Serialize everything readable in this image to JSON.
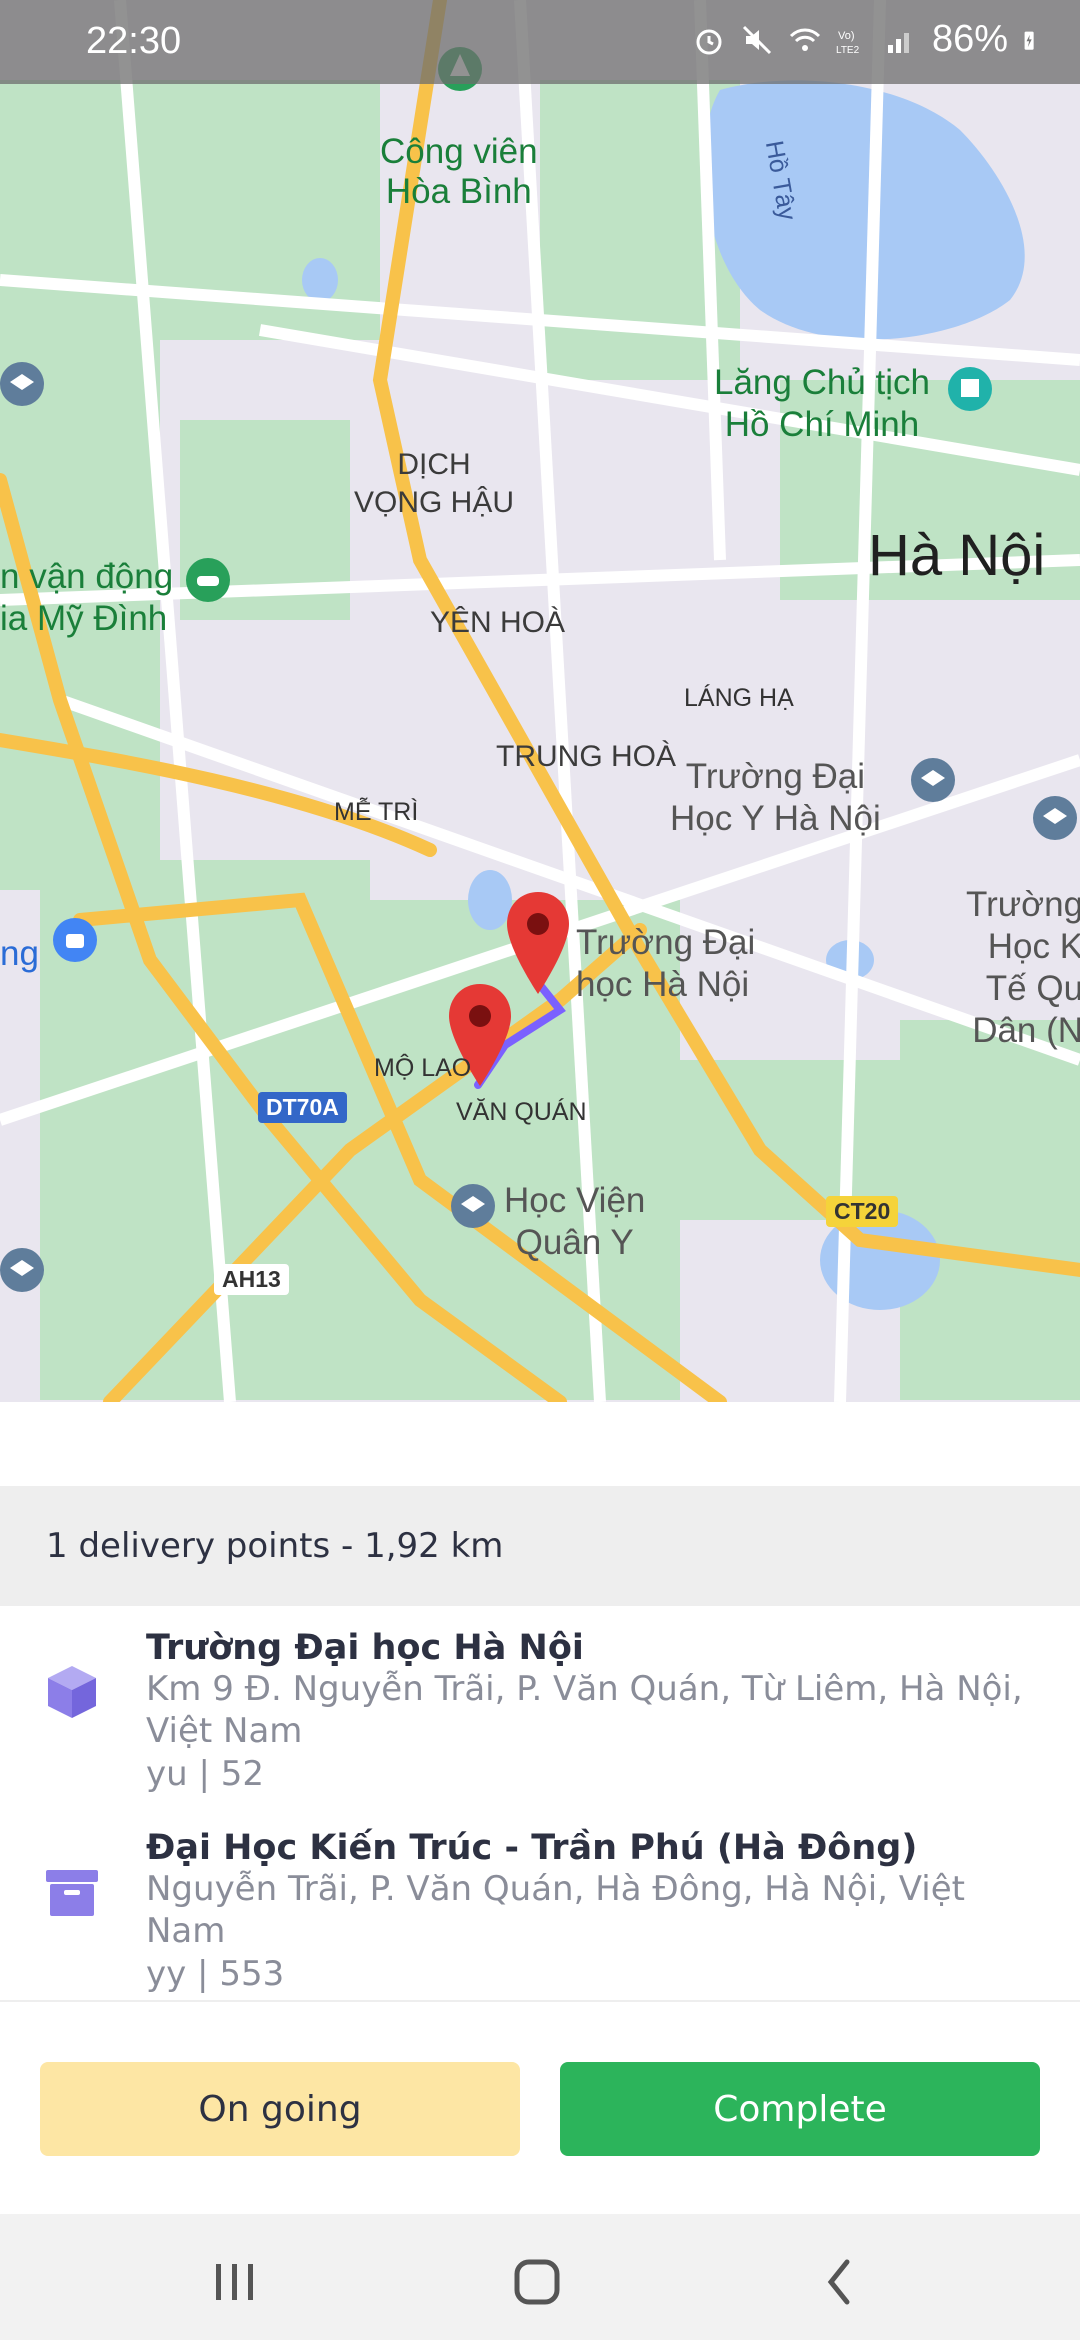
{
  "status_bar": {
    "time": "22:30",
    "battery": "86%",
    "icons": [
      "alarm-icon",
      "mute-icon",
      "wifi-icon",
      "volte-icon",
      "signal-icon",
      "battery-icon"
    ]
  },
  "map": {
    "labels": {
      "park": "Công viên\nHòa Bình",
      "lake": "Hồ Tây",
      "mausoleum": "Lăng Chủ tịch\nHồ Chí Minh",
      "hanoi": "Hà Nội",
      "dich_vong_hau": "DỊCH\nVỌNG HẬU",
      "stadium": "n vận động\nia Mỹ Đình",
      "yen_hoa": "YÊN HOÀ",
      "lang_ha": "LÁNG HẠ",
      "trung_hoa": "TRUNG HOÀ",
      "medical_uni": "Trường Đại\nHọc Y Hà Nội",
      "me_tri": "MỄ TRÌ",
      "ng": "ng",
      "nat_econ": "Trường\nHọc K\nTế Qu\nDân (N",
      "hanu": "Trường Đại\nhọc Hà Nội",
      "mo_lao": "MỘ LAO",
      "van_quan": "VĂN QUÁN",
      "military_academy": "Học Viện\nQuân Y"
    },
    "road_badges": {
      "dt70a": "DT70A",
      "ct20": "CT20",
      "ah13": "AH13"
    },
    "colors": {
      "background": "#e9e6ef",
      "green": "#bfe3c5",
      "water": "#a8c9f5",
      "road": "#f8c24a",
      "marker": "#e53935",
      "route": "#7b61ff"
    }
  },
  "summary": {
    "text": "1 delivery points - 1,92 km"
  },
  "items": [
    {
      "icon": "package-box-icon",
      "title": "Trường Đại học Hà Nội",
      "address": "Km 9 Đ. Nguyễn Trãi, P. Văn Quán, Từ Liêm, Hà Nội, Việt Nam",
      "meta": "yu | 52"
    },
    {
      "icon": "archive-box-icon",
      "title": "Đại Học Kiến Trúc - Trần Phú (Hà Đông)",
      "address": "Nguyễn Trãi, P. Văn Quán, Hà Đông, Hà Nội, Việt Nam",
      "meta": "yy | 553"
    }
  ],
  "buttons": {
    "ongoing": "On going",
    "complete": "Complete"
  },
  "accent": {
    "ongoing_bg": "#fde6a4",
    "complete_bg": "#2cb45b",
    "item_icon": "#8c7ee8"
  }
}
